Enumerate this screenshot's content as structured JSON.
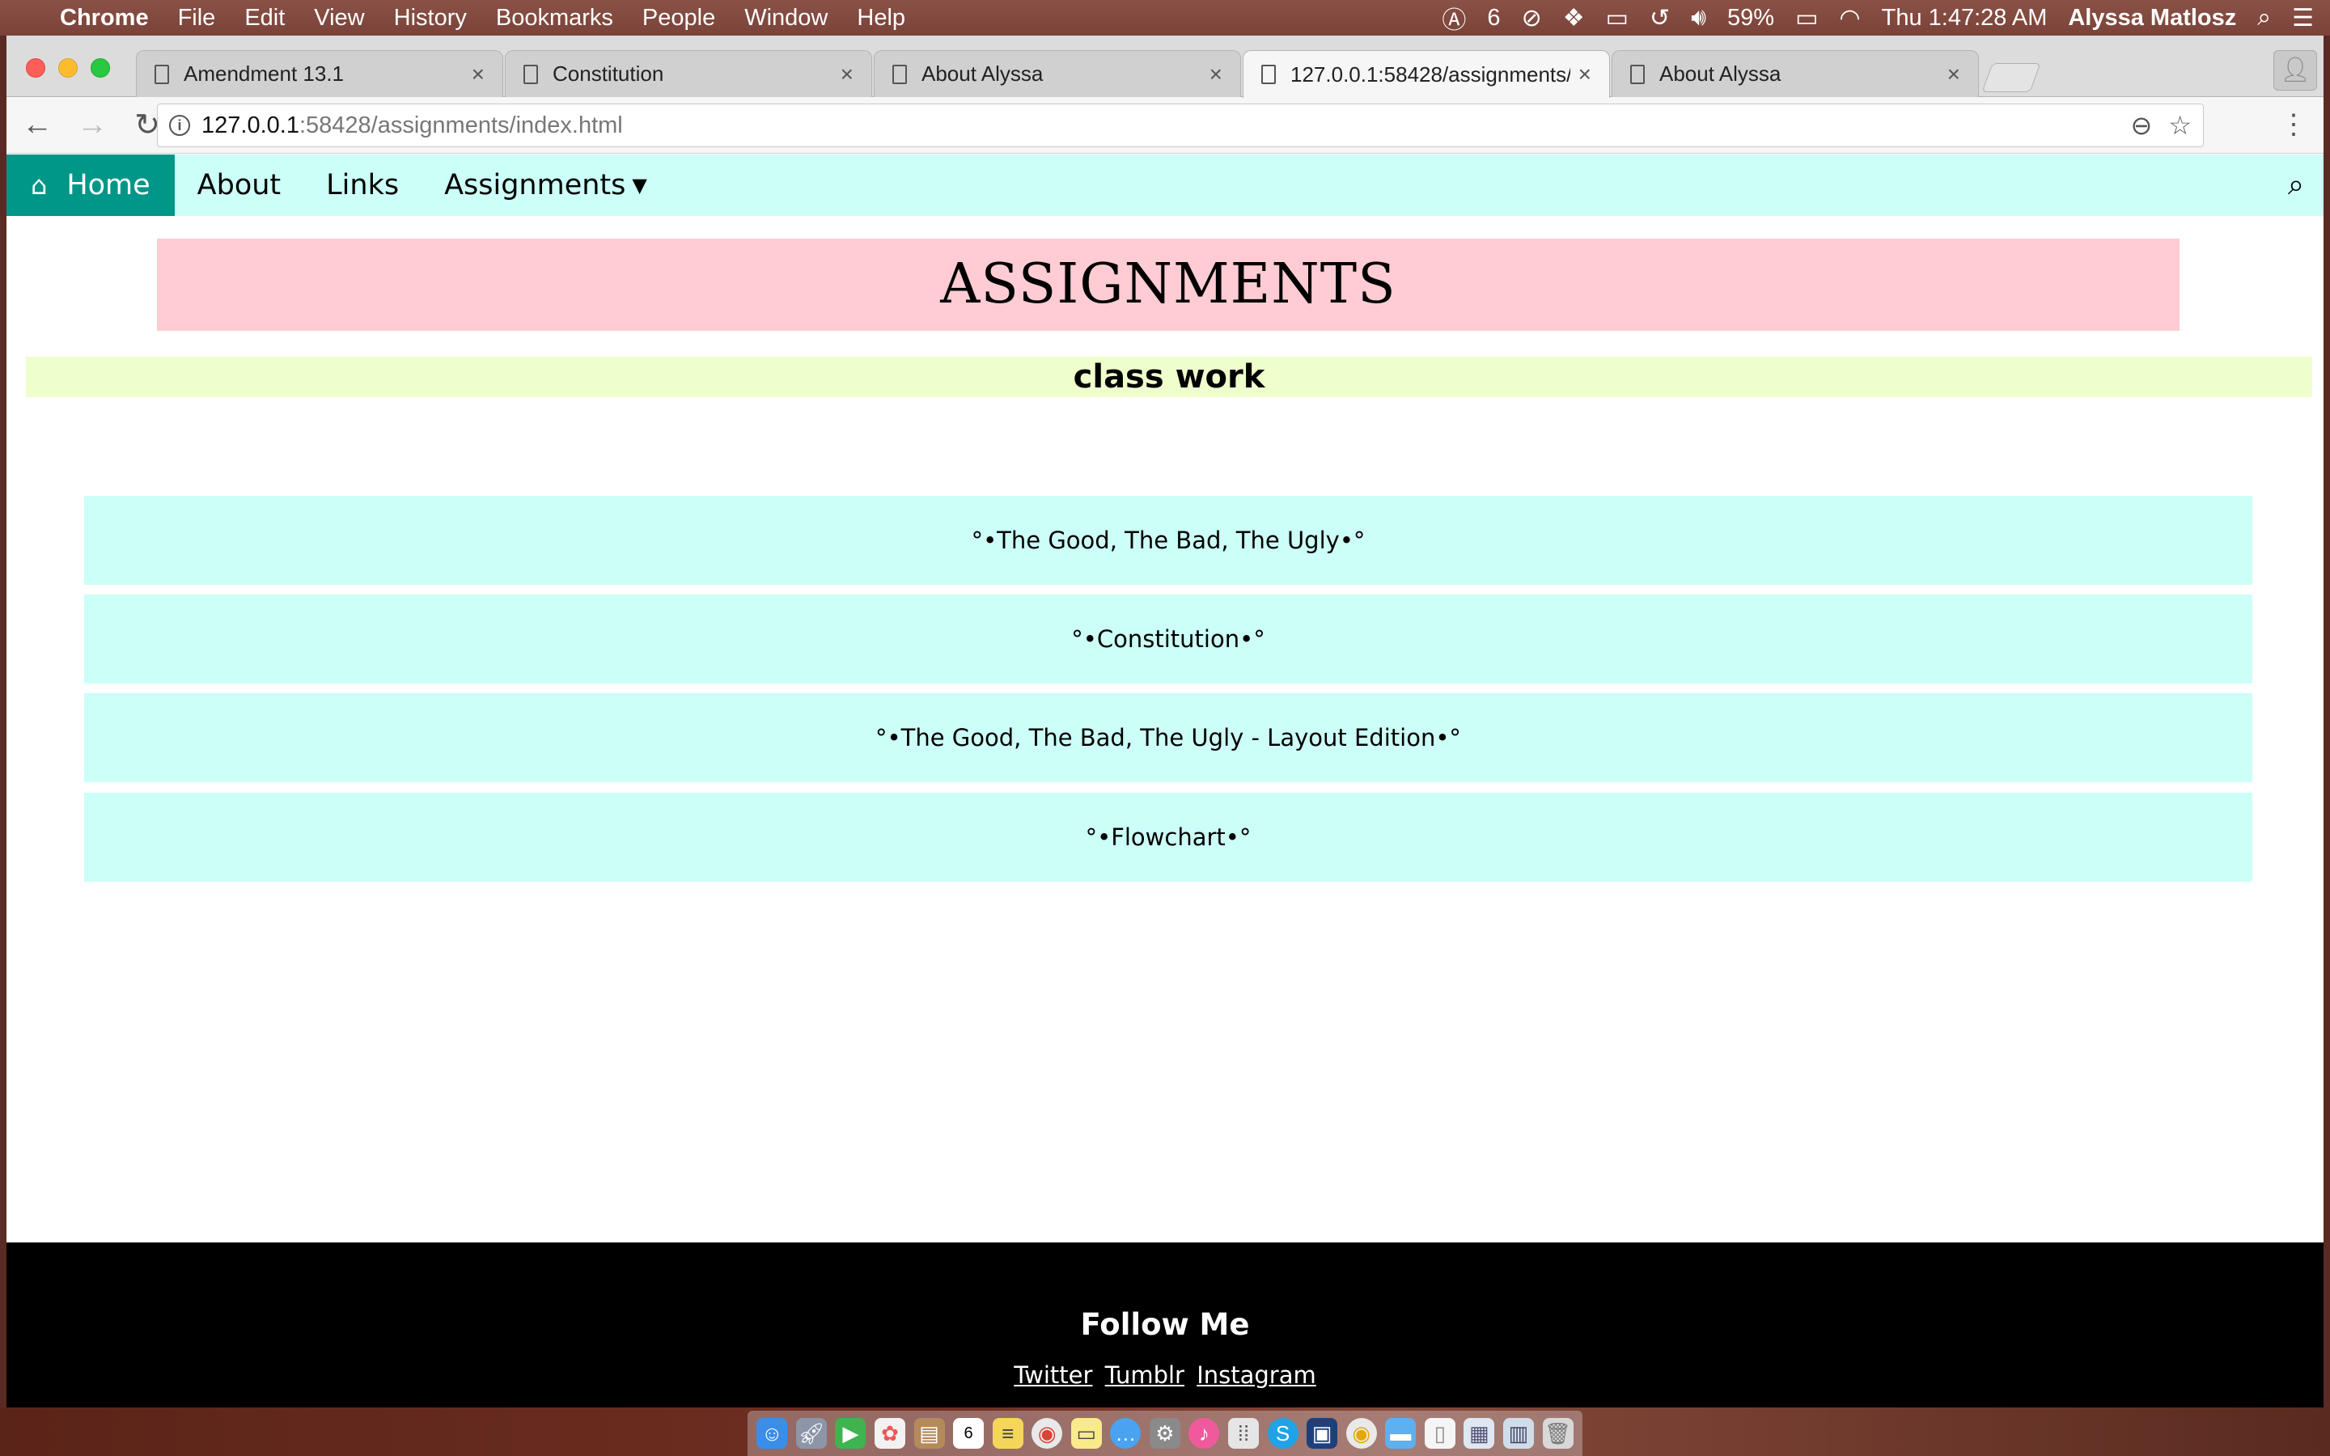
{
  "menubar": {
    "app_name": "Chrome",
    "items": [
      "File",
      "Edit",
      "View",
      "History",
      "Bookmarks",
      "People",
      "Window",
      "Help"
    ],
    "adobe_count": "6",
    "battery": "59%",
    "clock": "Thu 1:47:28 AM",
    "user": "Alyssa Matlosz"
  },
  "tabs": [
    {
      "title": "Amendment 13.1",
      "active": false
    },
    {
      "title": "Constitution",
      "active": false
    },
    {
      "title": "About Alyssa",
      "active": false
    },
    {
      "title": "127.0.0.1:58428/assignments/",
      "active": true
    },
    {
      "title": "About Alyssa",
      "active": false
    }
  ],
  "address": {
    "host": "127.0.0.1",
    "path": ":58428/assignments/index.html"
  },
  "site_nav": {
    "home": "Home",
    "about": "About",
    "links": "Links",
    "assignments": "Assignments"
  },
  "page": {
    "title": "ASSIGNMENTS",
    "subtitle": "class work",
    "assignments": [
      "°•The Good, The Bad, The Ugly•°",
      "°•Constitution•°",
      "°•The Good, The Bad, The Ugly - Layout Edition•°",
      "°•Flowchart•°"
    ]
  },
  "footer": {
    "heading": "Follow Me",
    "links": [
      "Twitter",
      "Tumblr",
      "Instagram"
    ]
  },
  "dock": {
    "icons": [
      "finder-icon",
      "launchpad-icon",
      "facetime-icon",
      "photos-icon",
      "contacts-icon",
      "calendar-icon",
      "notes-icon",
      "chrome-icon",
      "stickies-icon",
      "messages-icon",
      "system-preferences-icon",
      "itunes-icon",
      "app-grid-icon",
      "skype-icon",
      "textwrangler-icon",
      "chrome-canary-icon",
      "folder-icon",
      "document-icon",
      "screenshot-icon",
      "preview-icon",
      "trash-icon"
    ],
    "calendar_day": "6"
  }
}
